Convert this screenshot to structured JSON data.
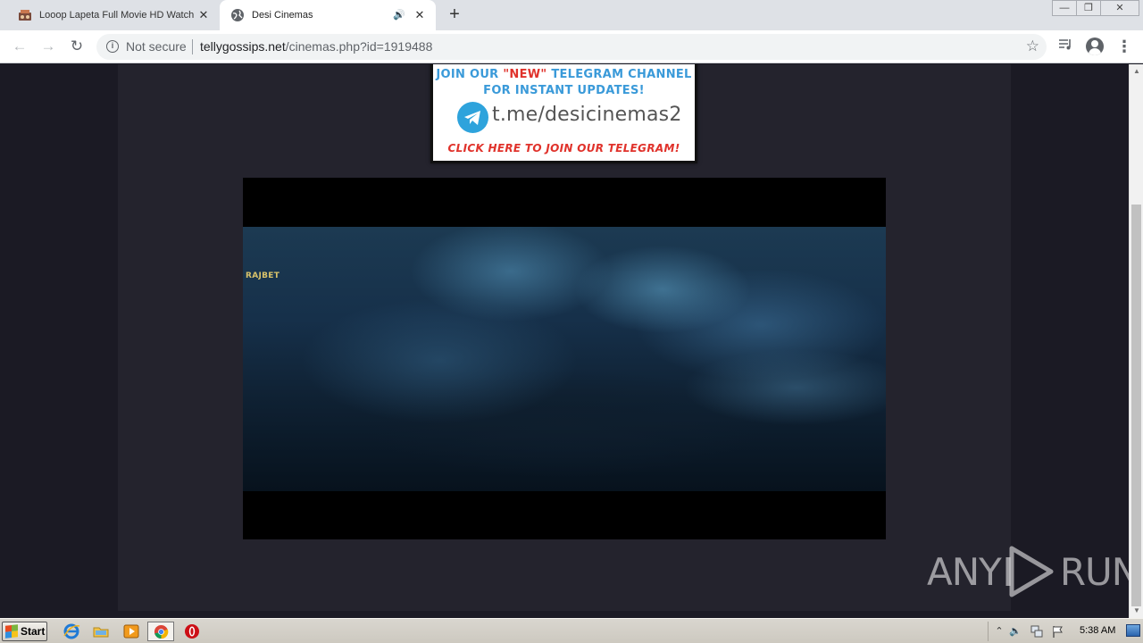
{
  "browser": {
    "tabs": [
      {
        "title": "Looop Lapeta Full Movie HD Watch Online",
        "favicon": "movie-site-favicon",
        "active": false
      },
      {
        "title": "Desi Cinemas",
        "favicon": "globe-icon",
        "active": true,
        "audio": "audio-playing-icon"
      }
    ],
    "new_tab_glyph": "+",
    "address_bar": {
      "security_label": "Not secure",
      "url_host": "tellygossips.net",
      "url_path": "/cinemas.php?id=1919488"
    },
    "window_controls": [
      "minimize",
      "restore",
      "close"
    ]
  },
  "page": {
    "banner": {
      "line1_prefix": "JOIN OUR",
      "line1_highlight": "\"NEW\"",
      "line1_suffix": "TELEGRAM CHANNEL",
      "line2": "FOR INSTANT UPDATES!",
      "handle": "t.me/desicinemas2",
      "cta": "CLICK HERE TO JOIN OUR TELEGRAM!",
      "accent_blue": "#3a9ad9",
      "accent_red": "#e0322b"
    },
    "video": {
      "watermark": "RAJBET",
      "background": "#000000"
    },
    "column_background": "#24232d",
    "page_background": "#1b1a24"
  },
  "overlay": {
    "logo_left": "ANY",
    "logo_right": "RUN"
  },
  "taskbar": {
    "start_label": "Start",
    "pinned": [
      "internet-explorer-icon",
      "file-explorer-icon",
      "media-player-icon",
      "chrome-icon",
      "opera-icon"
    ],
    "clock": "5:38 AM",
    "tray": [
      "tray-expand-icon",
      "volume-icon",
      "network-icon",
      "action-center-flag-icon"
    ]
  }
}
